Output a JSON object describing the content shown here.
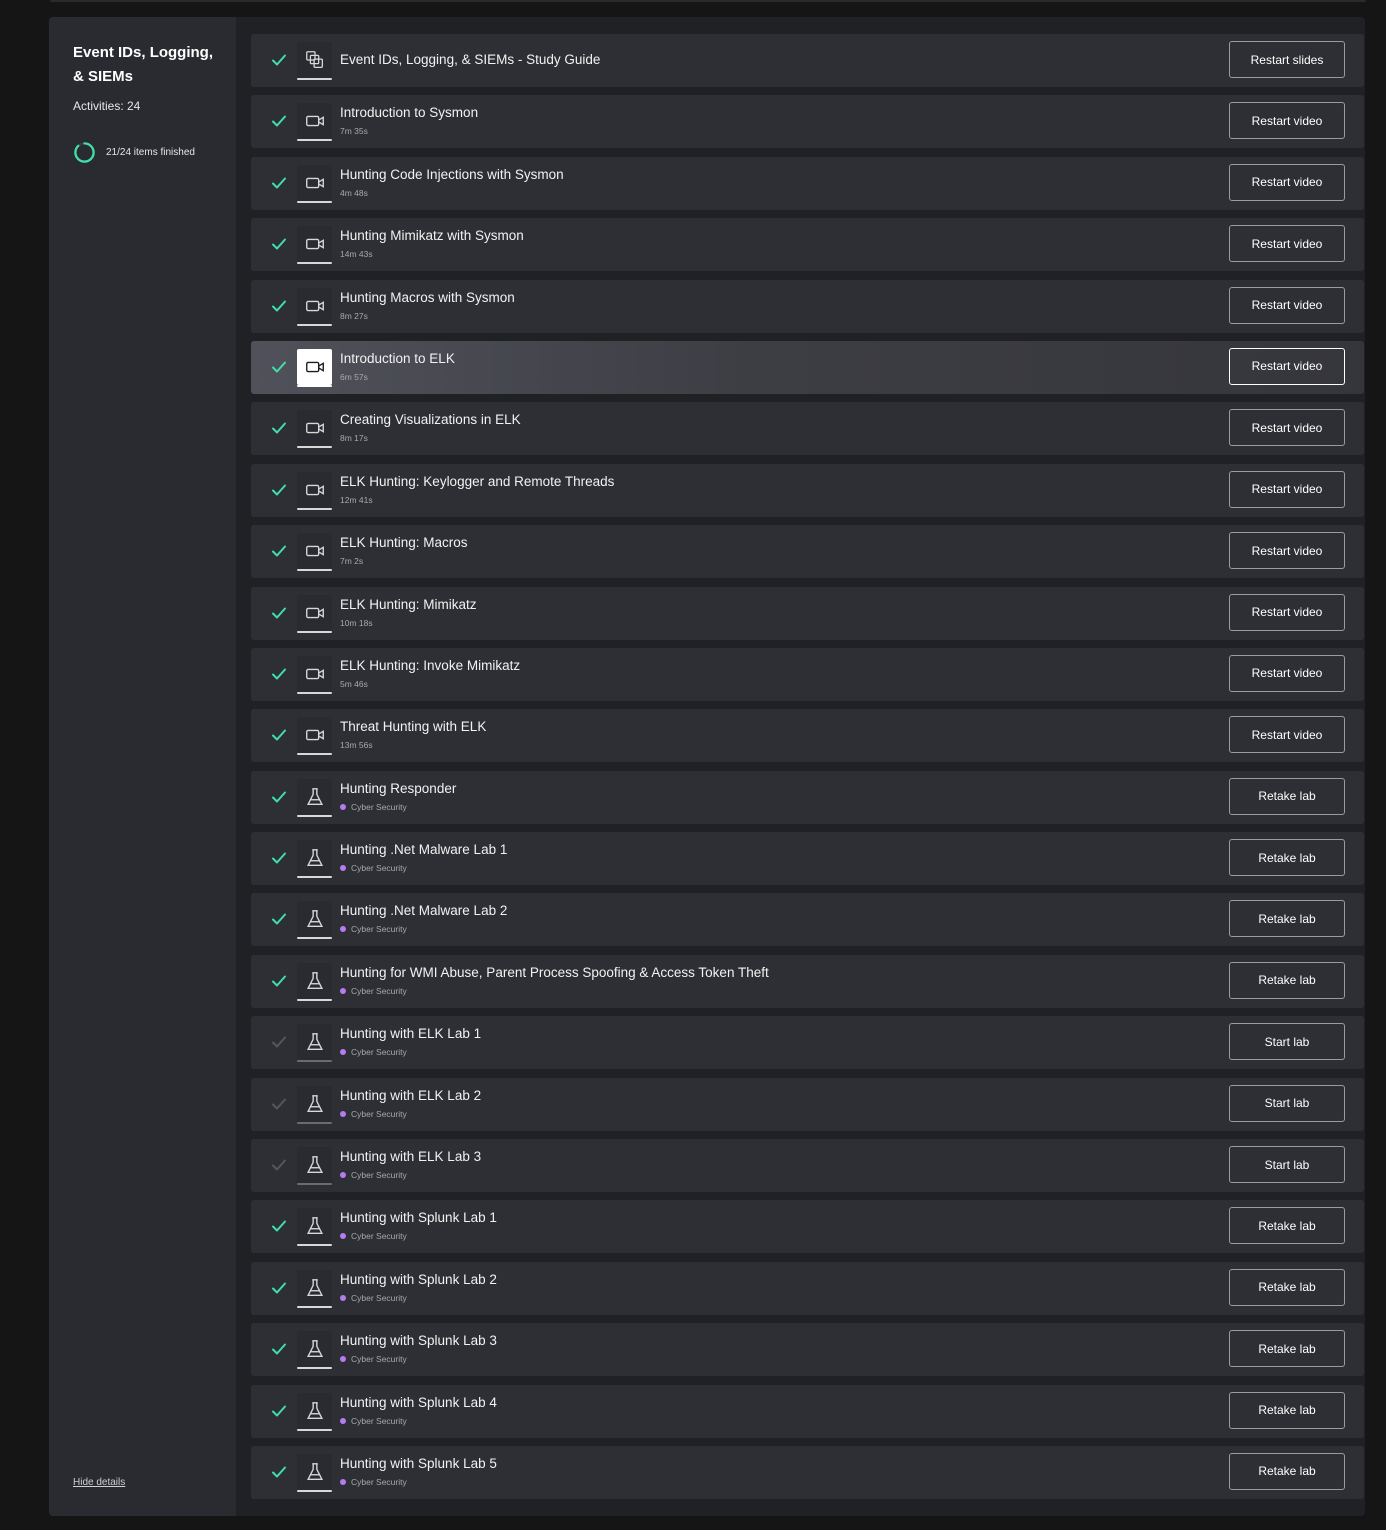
{
  "sidebar": {
    "title": "Event IDs, Logging, & SIEMs",
    "activities": "Activities: 24",
    "progress_text": "21/24 items finished",
    "progress_fraction": 0.875,
    "hide_details": "Hide details"
  },
  "colors": {
    "accent_green": "#3fe0a8",
    "lab_dot": "#b57cf0",
    "panel": "#202125",
    "row": "#2e2f35"
  },
  "items": [
    {
      "title": "Event IDs, Logging, & SIEMs - Study Guide",
      "sub": "",
      "type": "slides",
      "done": true,
      "button": "Restart slides"
    },
    {
      "title": "Introduction to Sysmon",
      "sub": "7m 35s",
      "type": "video",
      "done": true,
      "button": "Restart video"
    },
    {
      "title": "Hunting Code Injections with Sysmon",
      "sub": "4m 48s",
      "type": "video",
      "done": true,
      "button": "Restart video"
    },
    {
      "title": "Hunting Mimikatz with Sysmon",
      "sub": "14m 43s",
      "type": "video",
      "done": true,
      "button": "Restart video"
    },
    {
      "title": "Hunting Macros with Sysmon",
      "sub": "8m 27s",
      "type": "video",
      "done": true,
      "button": "Restart video"
    },
    {
      "title": "Introduction to ELK",
      "sub": "6m 57s",
      "type": "video",
      "done": true,
      "button": "Restart video",
      "active": true
    },
    {
      "title": "Creating Visualizations in ELK",
      "sub": "8m 17s",
      "type": "video",
      "done": true,
      "button": "Restart video"
    },
    {
      "title": "ELK Hunting: Keylogger and Remote Threads",
      "sub": "12m 41s",
      "type": "video",
      "done": true,
      "button": "Restart video"
    },
    {
      "title": "ELK Hunting: Macros",
      "sub": "7m 2s",
      "type": "video",
      "done": true,
      "button": "Restart video"
    },
    {
      "title": "ELK Hunting: Mimikatz",
      "sub": "10m 18s",
      "type": "video",
      "done": true,
      "button": "Restart video"
    },
    {
      "title": "ELK Hunting: Invoke Mimikatz",
      "sub": "5m 46s",
      "type": "video",
      "done": true,
      "button": "Restart video"
    },
    {
      "title": "Threat Hunting with ELK",
      "sub": "13m 56s",
      "type": "video",
      "done": true,
      "button": "Restart video"
    },
    {
      "title": "Hunting Responder",
      "sub": "Cyber Security",
      "type": "lab",
      "done": true,
      "button": "Retake lab"
    },
    {
      "title": "Hunting .Net Malware Lab 1",
      "sub": "Cyber Security",
      "type": "lab",
      "done": true,
      "button": "Retake lab"
    },
    {
      "title": "Hunting .Net Malware Lab 2",
      "sub": "Cyber Security",
      "type": "lab",
      "done": true,
      "button": "Retake lab"
    },
    {
      "title": "Hunting for WMI Abuse, Parent Process Spoofing & Access Token Theft",
      "sub": "Cyber Security",
      "type": "lab",
      "done": true,
      "button": "Retake lab"
    },
    {
      "title": "Hunting with ELK Lab 1",
      "sub": "Cyber Security",
      "type": "lab",
      "done": false,
      "button": "Start lab"
    },
    {
      "title": "Hunting with ELK Lab 2",
      "sub": "Cyber Security",
      "type": "lab",
      "done": false,
      "button": "Start lab"
    },
    {
      "title": "Hunting with ELK Lab 3",
      "sub": "Cyber Security",
      "type": "lab",
      "done": false,
      "button": "Start lab"
    },
    {
      "title": "Hunting with Splunk Lab 1",
      "sub": "Cyber Security",
      "type": "lab",
      "done": true,
      "button": "Retake lab"
    },
    {
      "title": "Hunting with Splunk Lab 2",
      "sub": "Cyber Security",
      "type": "lab",
      "done": true,
      "button": "Retake lab"
    },
    {
      "title": "Hunting with Splunk Lab 3",
      "sub": "Cyber Security",
      "type": "lab",
      "done": true,
      "button": "Retake lab"
    },
    {
      "title": "Hunting with Splunk Lab 4",
      "sub": "Cyber Security",
      "type": "lab",
      "done": true,
      "button": "Retake lab"
    },
    {
      "title": "Hunting with Splunk Lab 5",
      "sub": "Cyber Security",
      "type": "lab",
      "done": true,
      "button": "Retake lab"
    }
  ]
}
